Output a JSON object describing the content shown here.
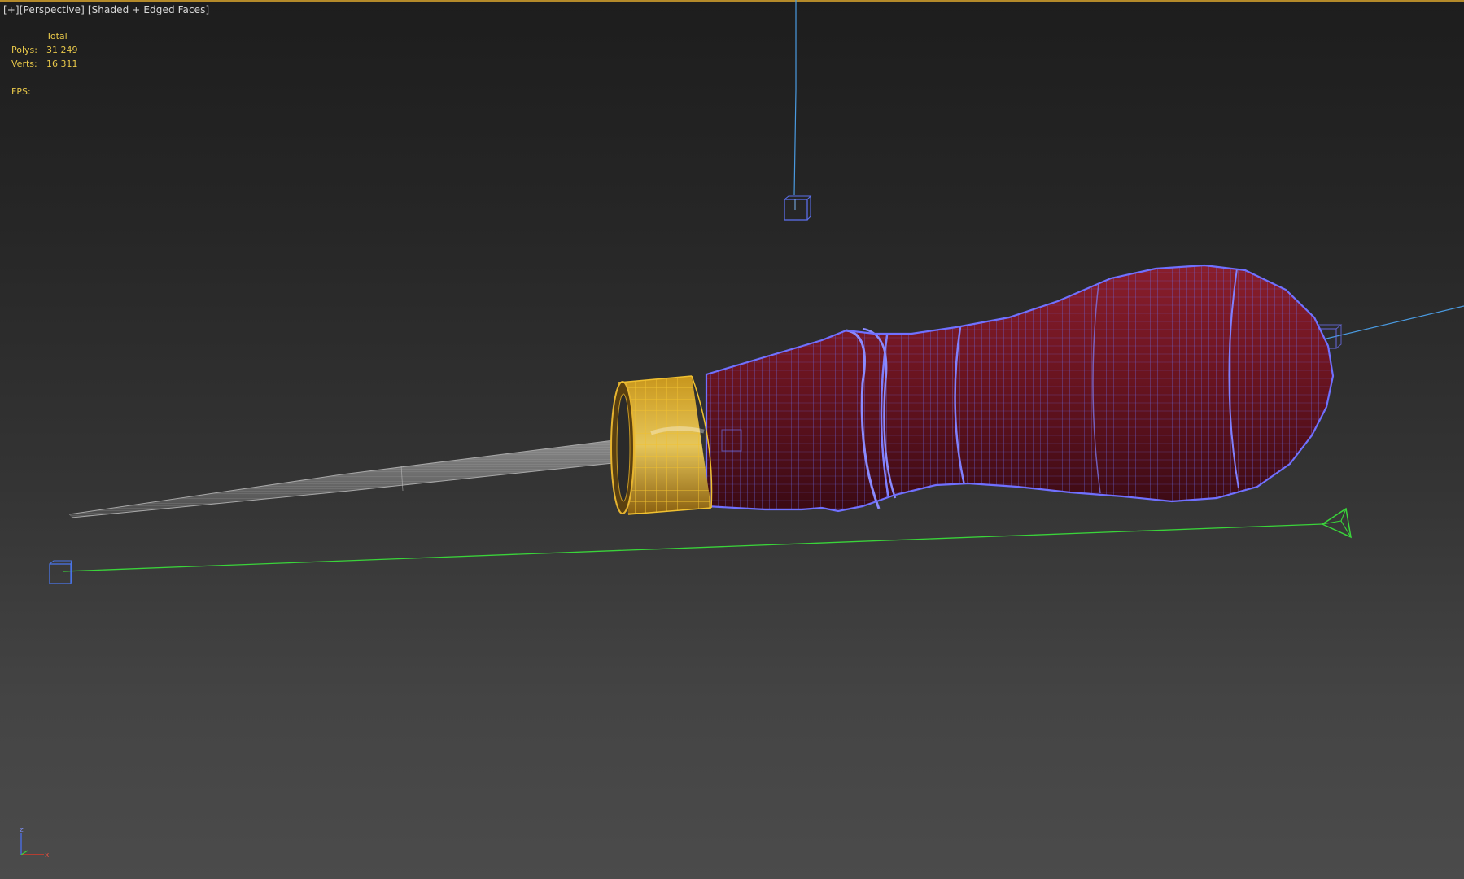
{
  "viewport": {
    "label_plus": "[+]",
    "label_view": "[Perspective]",
    "label_shading": "[Shaded + Edged Faces]"
  },
  "stats": {
    "header": "Total",
    "polys_label": "Polys:",
    "polys_value": "31 249",
    "verts_label": "Verts:",
    "verts_value": "16 311",
    "fps_label": "FPS:"
  },
  "axis": {
    "z_label": "z",
    "x_label": "x"
  },
  "colors": {
    "selection_border": "#b48a2a",
    "stats_text": "#e8c84a",
    "handle_wire": "#5a5ee8",
    "handle_fill": "#7a1a24",
    "ferrule_wire": "#d8a628",
    "blade_wire": "#9a9a9a",
    "light_blue": "#4a9ae0",
    "camera_green": "#3ad43a"
  },
  "icons": [
    "light-cube-icon",
    "camera-icon",
    "target-cube-icon",
    "axis-gizmo-icon"
  ]
}
